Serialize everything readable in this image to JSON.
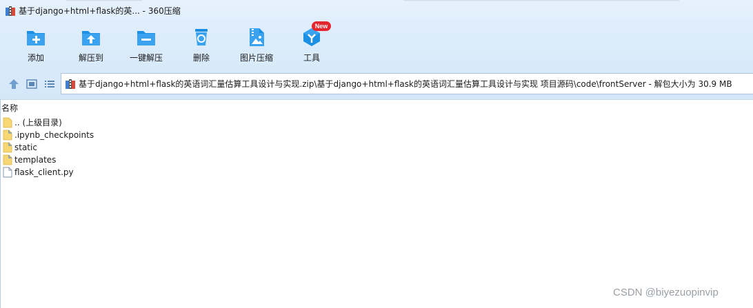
{
  "window": {
    "title": "基于django+html+flask的英... - 360压缩"
  },
  "toolbar": {
    "items": [
      {
        "label": "添加",
        "icon": "add-folder-icon"
      },
      {
        "label": "解压到",
        "icon": "extract-to-icon"
      },
      {
        "label": "一键解压",
        "icon": "one-click-extract-icon"
      },
      {
        "label": "删除",
        "icon": "recycle-bin-icon"
      },
      {
        "label": "图片压缩",
        "icon": "image-compress-icon"
      },
      {
        "label": "工具",
        "icon": "tools-icon"
      }
    ],
    "badge": "New"
  },
  "address": {
    "path": "基于django+html+flask的英语词汇量估算工具设计与实现.zip\\基于django+html+flask的英语词汇量估算工具设计与实现 项目源码\\code\\frontServer - 解包大小为 30.9 MB"
  },
  "list": {
    "column_name": "名称",
    "items": [
      {
        "name": ".. (上级目录)",
        "type": "folder",
        "icon": "parent-folder-icon"
      },
      {
        "name": ".ipynb_checkpoints",
        "type": "folder",
        "icon": "folder-icon"
      },
      {
        "name": "static",
        "type": "folder",
        "icon": "folder-icon"
      },
      {
        "name": "templates",
        "type": "folder",
        "icon": "folder-icon"
      },
      {
        "name": "flask_client.py",
        "type": "file",
        "icon": "file-icon"
      }
    ]
  },
  "watermark": "CSDN @biyezuopinvip",
  "colors": {
    "accent": "#1a8fe3",
    "toolbar_bg": "#dcecfb",
    "badge": "#e6262e"
  }
}
